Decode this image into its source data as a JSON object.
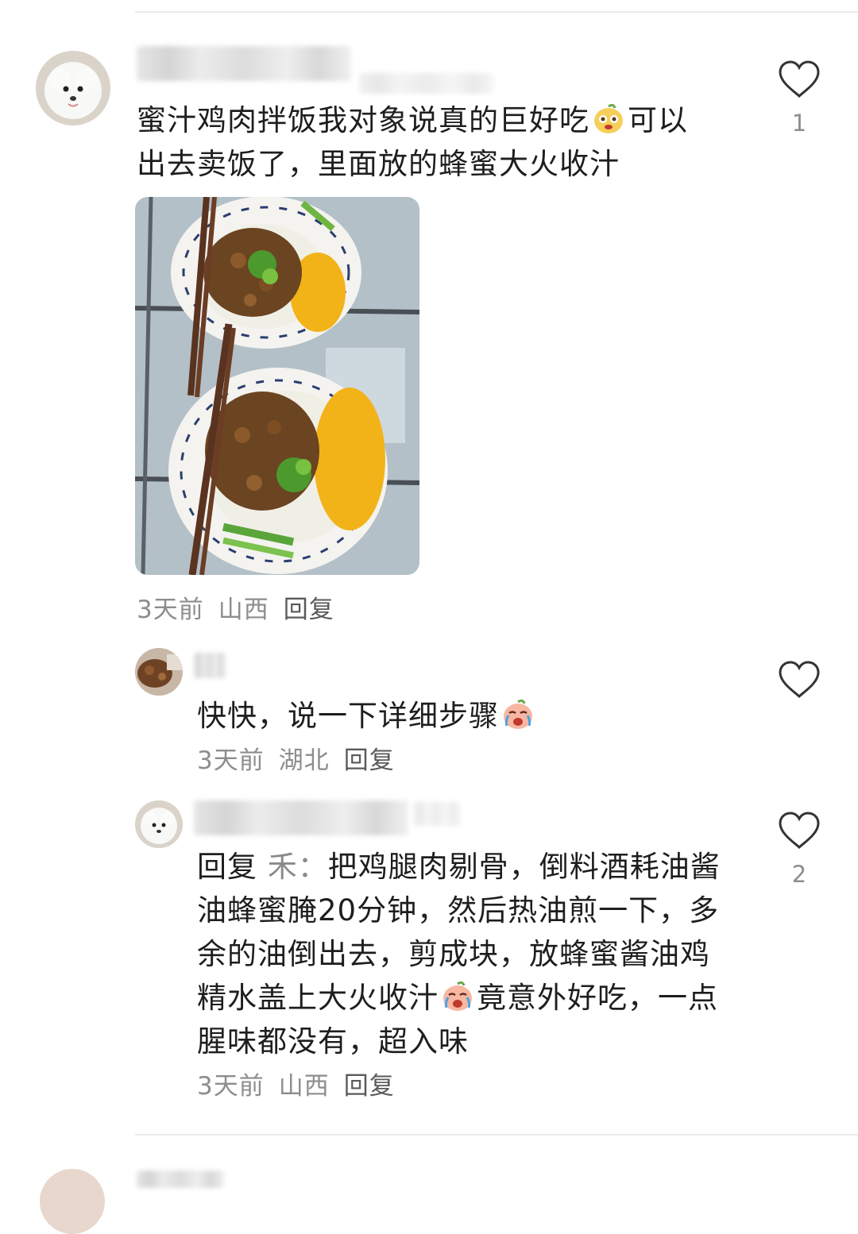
{
  "comments": [
    {
      "text_a": "蜜汁鸡肉拌饭我对象说真的巨好吃",
      "text_b": "可以出去卖饭了，里面放的蜂蜜大火收汁",
      "time": "3天前",
      "location": "山西",
      "reply_label": "回复",
      "likes": "1",
      "emoji": "peach-face-emoji"
    },
    {
      "text_a": "快快，说一下详细步骤",
      "time": "3天前",
      "location": "湖北",
      "reply_label": "回复",
      "emoji": "crying-peach-emoji"
    },
    {
      "reply_prefix": "回复",
      "mention": "禾：",
      "text_a": "把鸡腿肉剔骨，倒料酒耗油酱油蜂蜜腌20分钟，然后热油煎一下，多余的油倒出去，剪成块，放蜂蜜酱油鸡精水盖上大火收汁",
      "text_b": "竟意外好吃，一点腥味都没有，超入味",
      "time": "3天前",
      "location": "山西",
      "reply_label": "回复",
      "likes": "2",
      "emoji": "crying-peach-emoji"
    }
  ],
  "colors": {
    "text": "#1e1e1e",
    "meta": "#8d8d8d",
    "divider": "#ececec"
  }
}
